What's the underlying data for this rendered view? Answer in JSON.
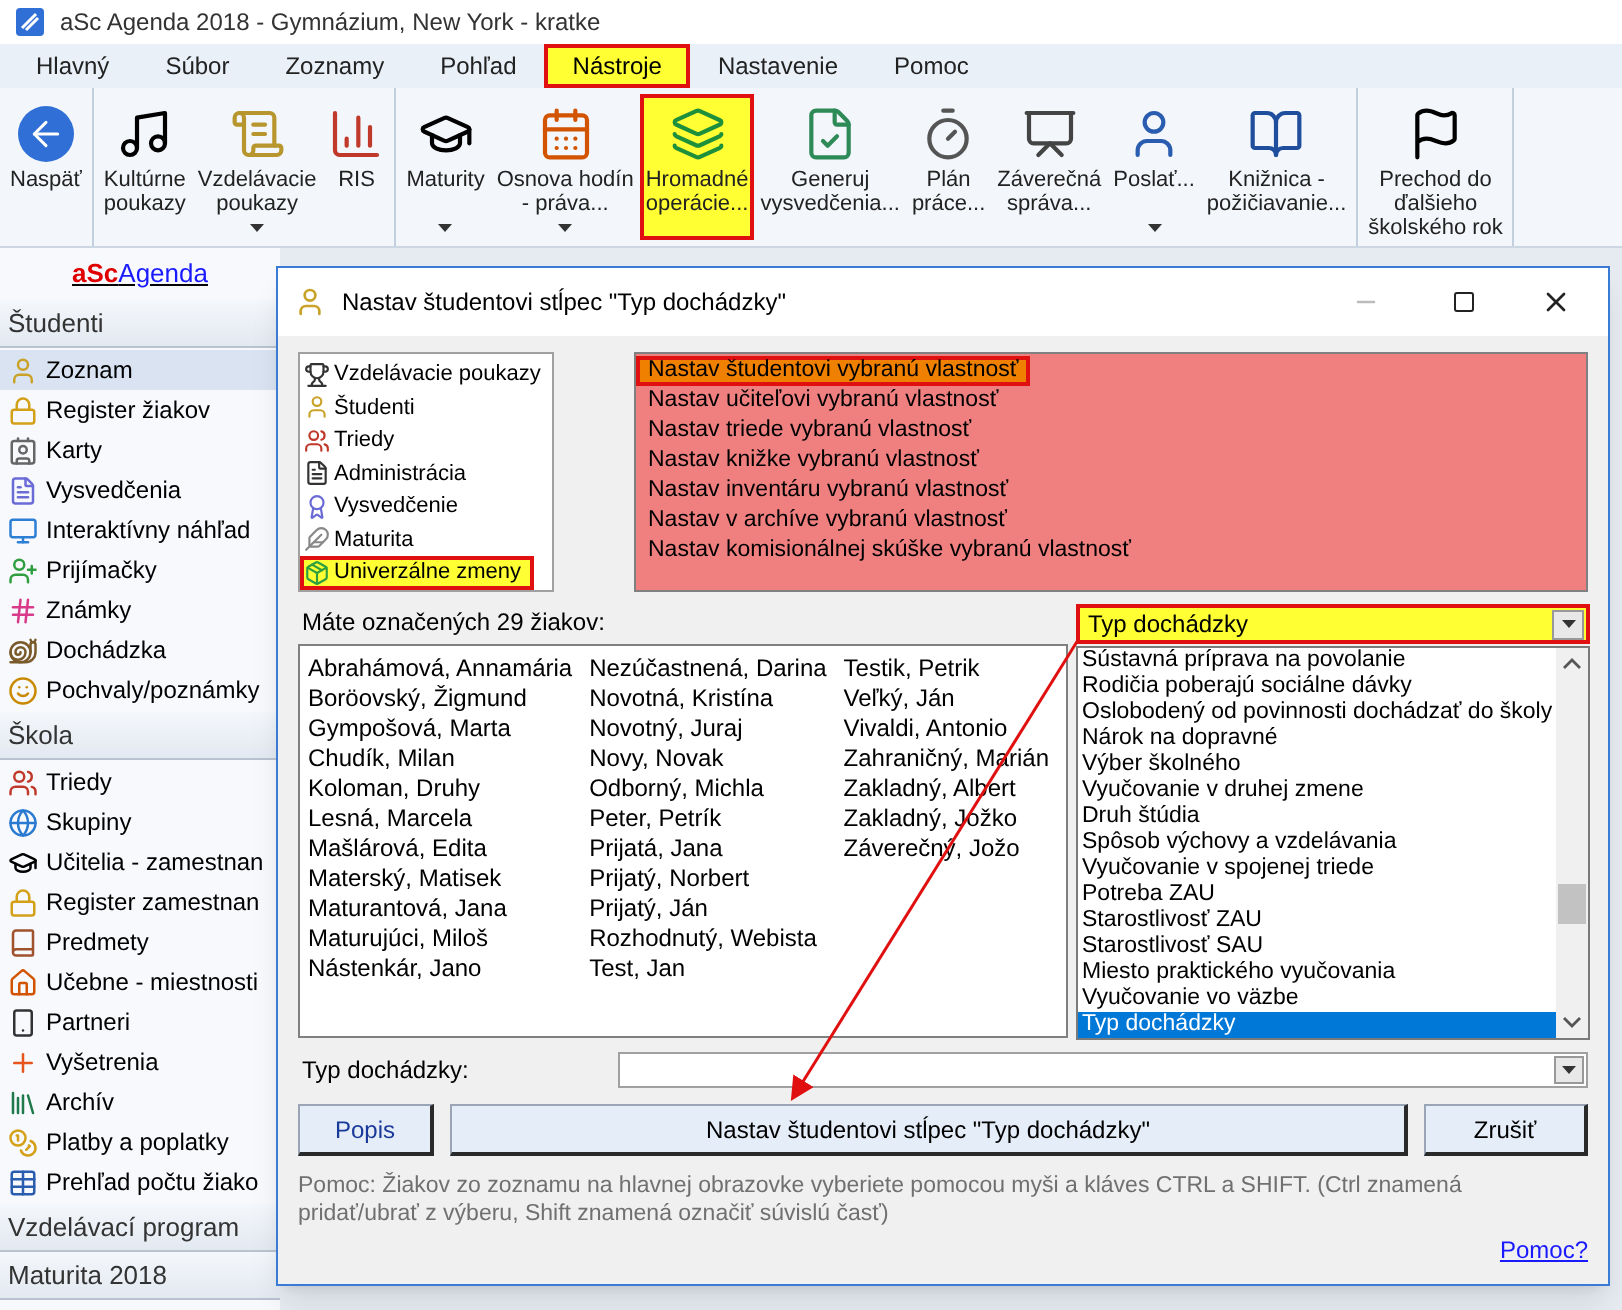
{
  "window": {
    "title": "aSc Agenda 2018 - Gymnázium, New York - kratke"
  },
  "menu": [
    {
      "label": "Hlavný",
      "selected": false,
      "highlighted": false
    },
    {
      "label": "Súbor",
      "selected": false,
      "highlighted": false
    },
    {
      "label": "Zoznamy",
      "selected": false,
      "highlighted": false
    },
    {
      "label": "Pohľad",
      "selected": false,
      "highlighted": false
    },
    {
      "label": "Nástroje",
      "selected": true,
      "highlighted": true
    },
    {
      "label": "Nastavenie",
      "selected": false,
      "highlighted": false
    },
    {
      "label": "Pomoc",
      "selected": false,
      "highlighted": false
    }
  ],
  "toolbar": {
    "groups": [
      [
        {
          "label": "Naspäť",
          "dropdown": false,
          "highlighted": false
        }
      ],
      [
        {
          "label": "Kultúrne\npoukazy",
          "dropdown": false,
          "highlighted": false
        },
        {
          "label": "Vzdelávacie\npoukazy",
          "dropdown": true,
          "highlighted": false
        },
        {
          "label": "RIS",
          "dropdown": false,
          "highlighted": false
        }
      ],
      [
        {
          "label": "Maturity",
          "dropdown": true,
          "highlighted": false
        },
        {
          "label": "Osnova hodín\n- práva...",
          "dropdown": true,
          "highlighted": false
        },
        {
          "label": "Hromadné\noperácie...",
          "dropdown": false,
          "highlighted": true
        },
        {
          "label": "Generuj\nvysvedčenia...",
          "dropdown": false,
          "highlighted": false
        },
        {
          "label": "Plán\npráce...",
          "dropdown": false,
          "highlighted": false
        },
        {
          "label": "Záverečná\nspráva...",
          "dropdown": false,
          "highlighted": false
        },
        {
          "label": "Poslať...",
          "dropdown": true,
          "highlighted": false
        },
        {
          "label": "Knižnica -\npožičiavanie...",
          "dropdown": false,
          "highlighted": false
        }
      ],
      [
        {
          "label": "Prechod do\nďalšieho\nškolského rok",
          "dropdown": false,
          "highlighted": false
        }
      ]
    ]
  },
  "sidebar": {
    "logo": {
      "prefix": "aSc",
      "suffix": "Agenda"
    },
    "sections": [
      {
        "title": "Študenti",
        "items": [
          {
            "label": "Zoznam",
            "selected": true
          },
          {
            "label": "Register žiakov",
            "selected": false
          },
          {
            "label": "Karty",
            "selected": false
          },
          {
            "label": "Vysvedčenia",
            "selected": false
          },
          {
            "label": "Interaktívny náhľad",
            "selected": false
          },
          {
            "label": "Prijímačky",
            "selected": false
          },
          {
            "label": "Známky",
            "selected": false
          },
          {
            "label": "Dochádzka",
            "selected": false
          },
          {
            "label": "Pochvaly/poznámky",
            "selected": false
          }
        ]
      },
      {
        "title": "Škola",
        "items": [
          {
            "label": "Triedy",
            "selected": false
          },
          {
            "label": "Skupiny",
            "selected": false
          },
          {
            "label": "Učitelia - zamestnan",
            "selected": false
          },
          {
            "label": "Register zamestnan",
            "selected": false
          },
          {
            "label": "Predmety",
            "selected": false
          },
          {
            "label": "Učebne - miestnosti",
            "selected": false
          },
          {
            "label": "Partneri",
            "selected": false
          },
          {
            "label": "Vyšetrenia",
            "selected": false
          },
          {
            "label": "Archív",
            "selected": false
          },
          {
            "label": "Platby a poplatky",
            "selected": false
          },
          {
            "label": "Prehľad počtu žiako",
            "selected": false
          }
        ]
      },
      {
        "title": "Vzdelávací program"
      },
      {
        "title": "Maturita 2018"
      }
    ]
  },
  "dialog": {
    "title": "Nastav študentovi stĺpec \"Typ dochádzky\"",
    "tree": [
      {
        "label": "Vzdelávacie poukazy",
        "highlighted": false
      },
      {
        "label": "Študenti",
        "highlighted": false
      },
      {
        "label": "Triedy",
        "highlighted": false
      },
      {
        "label": "Administrácia",
        "highlighted": false
      },
      {
        "label": "Vysvedčenie",
        "highlighted": false
      },
      {
        "label": "Maturita",
        "highlighted": false
      },
      {
        "label": "Univerzálne zmeny",
        "highlighted": true
      }
    ],
    "actions": [
      {
        "label": "Nastav študentovi vybranú vlastnosť",
        "selected": true,
        "highlighted": true
      },
      {
        "label": "Nastav učiteľovi vybranú vlastnosť",
        "selected": false,
        "highlighted": false
      },
      {
        "label": "Nastav triede vybranú vlastnosť",
        "selected": false,
        "highlighted": false
      },
      {
        "label": "Nastav knižke vybranú vlastnosť",
        "selected": false,
        "highlighted": false
      },
      {
        "label": "Nastav inventáru vybranú vlastnosť",
        "selected": false,
        "highlighted": false
      },
      {
        "label": "Nastav v archíve vybranú vlastnosť",
        "selected": false,
        "highlighted": false
      },
      {
        "label": "Nastav komisionálnej skúške vybranú vlastnosť",
        "selected": false,
        "highlighted": false
      }
    ],
    "count_label": "Máte označených 29 žiakov:",
    "students": [
      "Abrahámová, Annamária",
      "Boröovský, Žigmund",
      "Gympošová, Marta",
      "Chudík, Milan",
      "Koloman, Druhy",
      "Lesná, Marcela",
      "Mašlárová, Edita",
      "Materský, Matisek",
      "Maturantová, Jana",
      "Maturujúci, Miloš",
      "Nástenkár, Jano",
      "Nezúčastnená, Darina",
      "Novotná, Kristína",
      "Novotný, Juraj",
      "Novy, Novak",
      "Odborný, Michla",
      "Peter, Petrík",
      "Prijatá, Jana",
      "Prijatý, Norbert",
      "Prijatý, Ján",
      "Rozhodnutý, Webista",
      "Test, Jan",
      "Testik, Petrik",
      "Veľký, Ján",
      "Vivaldi, Antonio",
      "Zahraničný, Marián",
      "Zakladný, Albert",
      "Zakladný, Jožko",
      "Záverečný, Jožo"
    ],
    "column_combo": {
      "value": "Typ dochádzky",
      "highlighted": true
    },
    "options": [
      {
        "label": "Sústavná príprava na povolanie",
        "selected": false
      },
      {
        "label": "Rodičia poberajú sociálne dávky",
        "selected": false
      },
      {
        "label": "Oslobodený od povinnosti dochádzať do školy",
        "selected": false
      },
      {
        "label": "Nárok na dopravné",
        "selected": false
      },
      {
        "label": "Výber školného",
        "selected": false
      },
      {
        "label": "Vyučovanie v druhej zmene",
        "selected": false
      },
      {
        "label": "Druh štúdia",
        "selected": false
      },
      {
        "label": "Spôsob výchovy a vzdelávania",
        "selected": false
      },
      {
        "label": "Vyučovanie v spojenej triede",
        "selected": false
      },
      {
        "label": "Potreba ZAU",
        "selected": false
      },
      {
        "label": "Starostlivosť ZAU",
        "selected": false
      },
      {
        "label": "Starostlivosť SAU",
        "selected": false
      },
      {
        "label": "Miesto praktického vyučovania",
        "selected": false
      },
      {
        "label": "Vyučovanie vo väzbe",
        "selected": false
      },
      {
        "label": "Typ dochádzky",
        "selected": true
      }
    ],
    "value_label": "Typ dochádzky:",
    "buttons": [
      "Popis",
      "Nastav študentovi stĺpec \"Typ dochádzky\"",
      "Zrušiť"
    ],
    "help": "Pomoc: Žiakov zo zoznamu na hlavnej obrazovke vyberiete pomocou myši a kláves CTRL a SHIFT. (Ctrl znamená pridať/ubrať z výberu, Shift znamená označiť súvislú časť)",
    "help_link": "Pomoc?"
  }
}
